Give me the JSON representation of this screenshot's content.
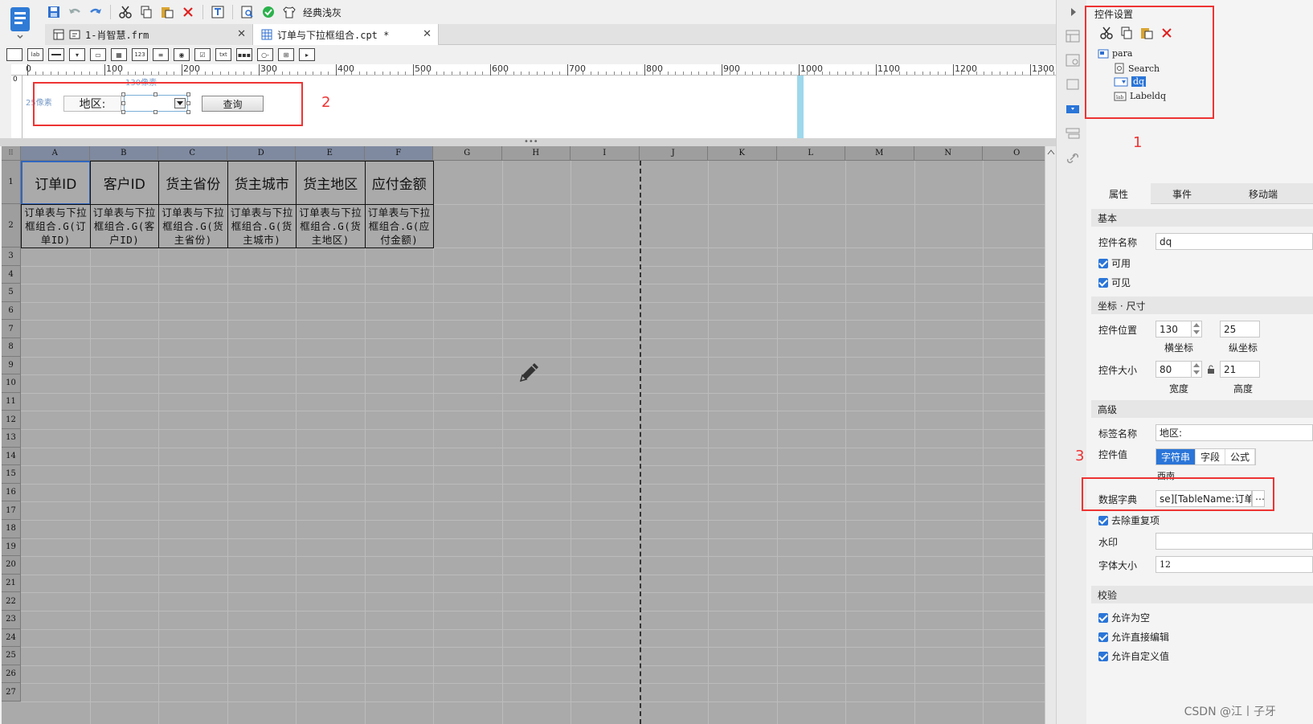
{
  "toolbar": {
    "style_label": "经典浅灰"
  },
  "tabs": [
    {
      "label": "1-肖智慧.frm",
      "active": false
    },
    {
      "label": "订单与下拉框组合.cpt *",
      "active": true
    }
  ],
  "widget_bar": {
    "label_widget": "lab",
    "number_widget": "123",
    "text_widget": "txt"
  },
  "ruler": {
    "origin": "0",
    "marks": [
      "100",
      "200",
      "300",
      "400",
      "500",
      "600",
      "700",
      "800",
      "900",
      "1000",
      "1100",
      "1200",
      "1300"
    ]
  },
  "param": {
    "hint_x": "130像素",
    "hint_y": "25像素",
    "label_text": "地区:",
    "query_button": "查询",
    "callouts": [
      "2"
    ]
  },
  "grid": {
    "columns": [
      "A",
      "B",
      "C",
      "D",
      "E",
      "F",
      "G",
      "H",
      "I",
      "J",
      "K",
      "L",
      "M",
      "N",
      "O"
    ],
    "rows": [
      "1",
      "2",
      "3",
      "4",
      "5",
      "6",
      "7",
      "8",
      "9",
      "10",
      "11",
      "12",
      "13",
      "14",
      "15",
      "16",
      "17",
      "18",
      "19",
      "20",
      "21",
      "22",
      "23",
      "24",
      "25",
      "26",
      "27"
    ],
    "headers": [
      "订单ID",
      "客户ID",
      "货主省份",
      "货主城市",
      "货主地区",
      "应付金额"
    ],
    "expressions": [
      "订单表与下拉框组合.G(订单ID)",
      "订单表与下拉框组合.G(客户ID)",
      "订单表与下拉框组合.G(货主省份)",
      "订单表与下拉框组合.G(货主城市)",
      "订单表与下拉框组合.G(货主地区)",
      "订单表与下拉框组合.G(应付金额)"
    ]
  },
  "right_panel": {
    "title": "控件设置",
    "callout_1": "1",
    "callout_3": "3",
    "tree": [
      {
        "label": "para",
        "selected": false
      },
      {
        "label": "Search",
        "selected": false
      },
      {
        "label": "dq",
        "selected": true
      },
      {
        "label": "Labeldq",
        "selected": false
      }
    ],
    "tabs": [
      "属性",
      "事件",
      "移动端"
    ],
    "sections": {
      "basic": "基本",
      "geometry": "坐标 · 尺寸",
      "advanced": "高级",
      "validate": "校验"
    },
    "fields": {
      "widget_name_label": "控件名称",
      "widget_name": "dq",
      "enabled": "可用",
      "visible": "可见",
      "position_label": "控件位置",
      "pos_x": "130",
      "pos_y": "25",
      "pos_x_cap": "横坐标",
      "pos_y_cap": "纵坐标",
      "size_label": "控件大小",
      "width": "80",
      "height": "21",
      "width_cap": "宽度",
      "height_cap": "高度",
      "label_name_label": "标签名称",
      "label_name": "地区:",
      "value_label": "控件值",
      "value_types": [
        "字符串",
        "字段",
        "公式"
      ],
      "value_text": "西南",
      "dict_label": "数据字典",
      "dict_value": "se][TableName:订单]",
      "dedupe": "去除重复项",
      "watermark_label": "水印",
      "font_size_label": "字体大小",
      "font_size": "12",
      "allow_empty": "允许为空",
      "allow_edit": "允许直接编辑",
      "allow_custom": "允许自定义值"
    }
  },
  "footer_watermark": "CSDN @江丨子牙",
  "colors": {
    "accent": "#2a75d8",
    "callout": "#e33333",
    "grid_bg": "#aaaaaa"
  }
}
